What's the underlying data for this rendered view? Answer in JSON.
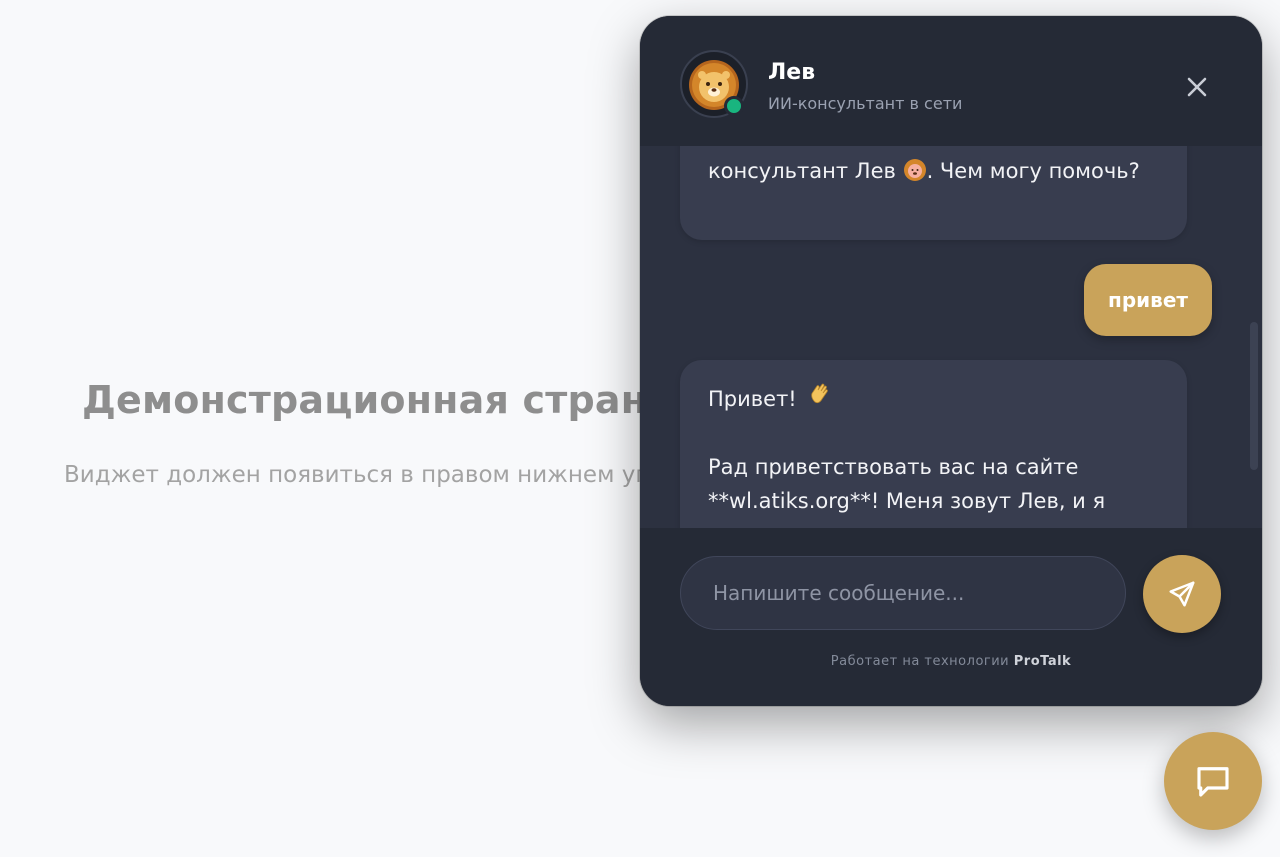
{
  "page": {
    "title": "Демонстрационная страница",
    "subtitle": "Виджет должен появиться в правом нижнем угл"
  },
  "widget": {
    "bot_name": "Лев",
    "bot_status": "ИИ-консультант в сети",
    "avatar_icon": "lion-icon",
    "close_icon": "close-icon",
    "messages": [
      {
        "from": "bot",
        "text": "консультант Лев",
        "text_after": ". Чем могу помочь?"
      },
      {
        "from": "user",
        "text": "привет"
      },
      {
        "from": "bot",
        "line1": "Привет!",
        "line2": "Рад приветствовать вас на сайте",
        "line3": "**wl.atiks.org**! Меня зовут Лев, и я готов"
      }
    ],
    "input": {
      "placeholder": "Напишите сообщение..."
    },
    "send_icon": "send-icon",
    "powered_prefix": "Работает на технологии",
    "powered_brand": "ProTalk"
  },
  "launcher_icon": "chat-icon",
  "colors": {
    "accent": "#c9a35a",
    "panel": "#2c3140",
    "header": "#252a36",
    "bot_bubble": "#383d4f",
    "online": "#19b57f"
  }
}
